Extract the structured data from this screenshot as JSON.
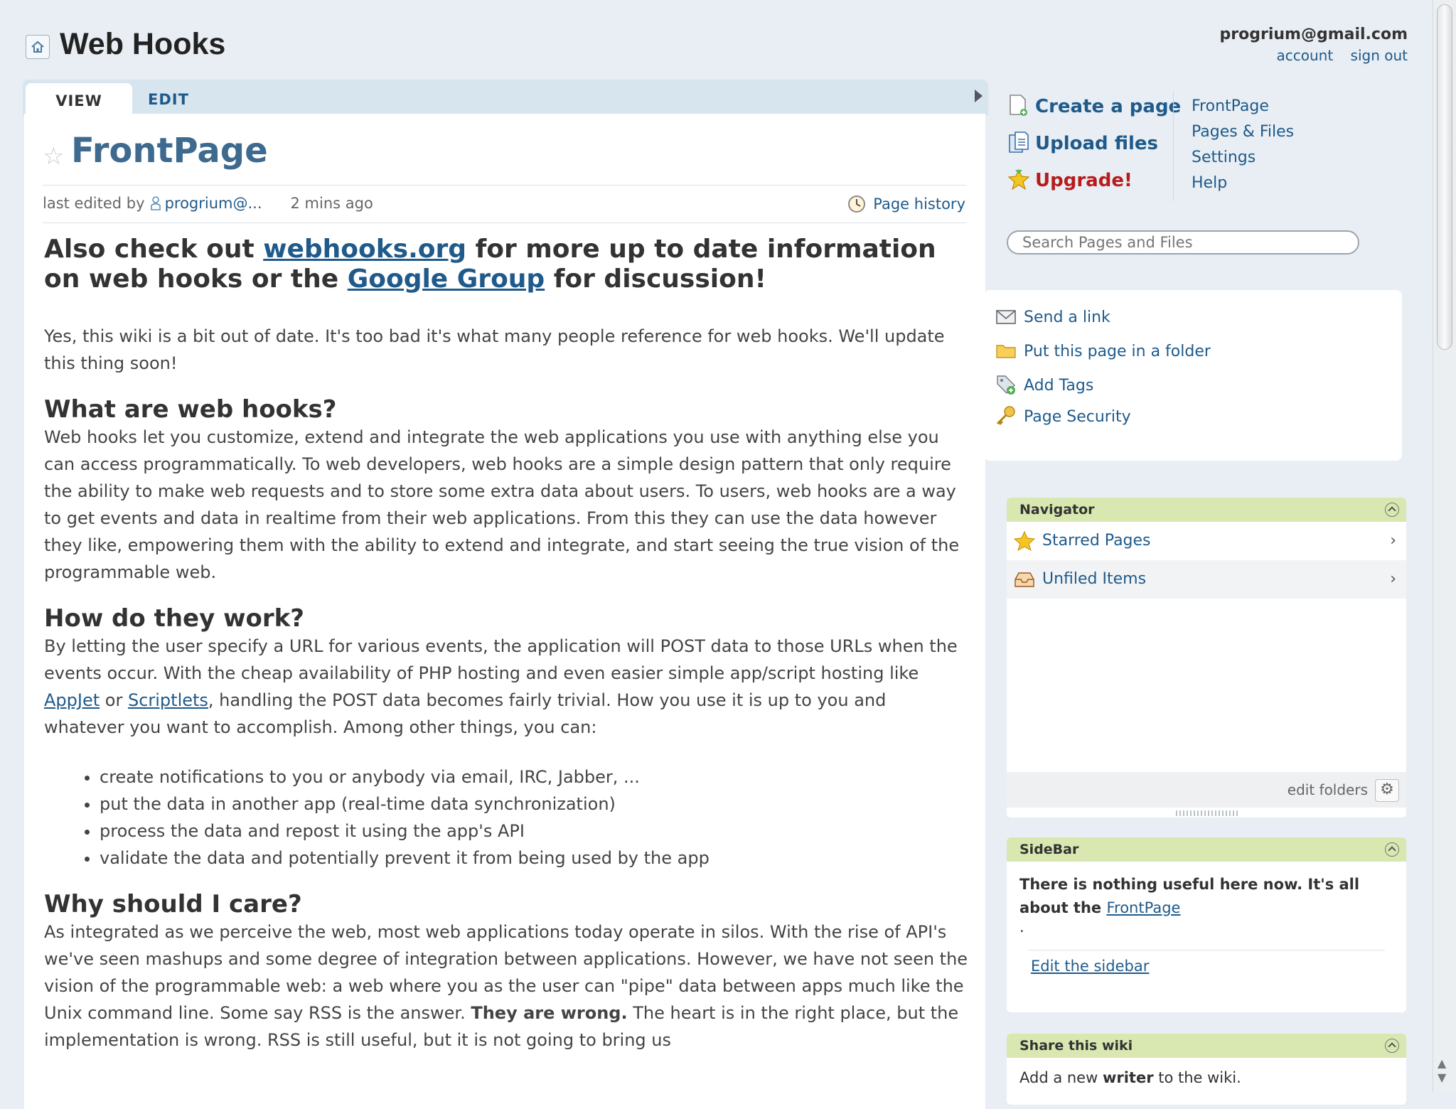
{
  "header": {
    "site_title": "Web Hooks",
    "user_email": "progrium@gmail.com",
    "account_link": "account",
    "sign_out_link": "sign out"
  },
  "tabs": {
    "view": "VIEW",
    "edit": "EDIT"
  },
  "page": {
    "title": "FrontPage",
    "last_edited_prefix": "last edited by",
    "editor": "progrium@...",
    "edited_ago": "2 mins ago",
    "history_link": "Page history"
  },
  "content": {
    "banner_a": "Also check out ",
    "banner_link1": "webhooks.org",
    "banner_b": " for more up to date information on web hooks or the ",
    "banner_link2": "Google Group",
    "banner_c": " for discussion!",
    "intro": "Yes, this wiki is a bit out of date. It's too bad it's what many people reference for web hooks. We'll update this thing soon!",
    "h_what": "What are web hooks?",
    "p_what": "Web hooks let you customize, extend and integrate the web applications you use with anything else you can access programmatically. To web developers, web hooks are a simple design pattern that only require the ability to make web requests and to store some extra data about users. To users, web hooks are a way to get events and data in realtime from their web applications. From this they can use the data however they like, empowering them with the ability to extend and integrate, and start seeing the true vision of the programmable web.",
    "h_how": "How do they work?",
    "p_how_a": "By letting the user specify a URL for various events, the application will POST data to those URLs when the events occur. With the cheap availability of PHP hosting and even easier simple app/script hosting like ",
    "p_how_link1": "AppJet",
    "p_how_b": " or ",
    "p_how_link2": "Scriptlets",
    "p_how_c": ", handling the POST data becomes fairly trivial. How you use it is up to you and whatever you want to accomplish. Among other things, you can:",
    "list": [
      "create notifications to you or anybody via email, IRC, Jabber, ...",
      "put the data in another app (real-time data synchronization)",
      "process the data and repost it using the app's API",
      "validate the data and potentially prevent it from being used by the app"
    ],
    "h_why": "Why should I care?",
    "p_why_a": "As integrated as we perceive the web, most web applications today operate in silos. With the rise of API's we've seen mashups and some degree of integration between applications. However, we have not seen the vision of the programmable web: a web where you as the user can \"pipe\" data between apps much like the Unix command line. Some say RSS is the answer. ",
    "p_why_bold": "They are wrong.",
    "p_why_b": " The heart is in the right place, but the implementation is wrong. RSS is still useful, but it is not going to bring us"
  },
  "actions": {
    "create": "Create a page",
    "upload": "Upload files",
    "upgrade": "Upgrade!"
  },
  "nav_links": [
    "FrontPage",
    "Pages & Files",
    "Settings",
    "Help"
  ],
  "search": {
    "placeholder": "Search Pages and Files"
  },
  "tools": {
    "send": "Send a link",
    "folder": "Put this page in a folder",
    "tags": "Add Tags",
    "security": "Page Security"
  },
  "navigator": {
    "title": "Navigator",
    "starred": "Starred Pages",
    "unfiled": "Unfiled Items",
    "edit_folders": "edit folders"
  },
  "sidebar_box": {
    "title": "SideBar",
    "text": "There is nothing useful here now. It's all about the ",
    "link": "FrontPage",
    "dot": ".",
    "edit": "Edit the sidebar"
  },
  "share": {
    "title": "Share this wiki",
    "text_a": "Add a new ",
    "text_bold": "writer",
    "text_b": " to the wiki."
  },
  "colors": {
    "accent": "#1f5a8a",
    "title": "#3d6a8e",
    "upgrade": "#b71c1c",
    "widget_header": "#d8e8b0",
    "background": "#e8eef3"
  }
}
